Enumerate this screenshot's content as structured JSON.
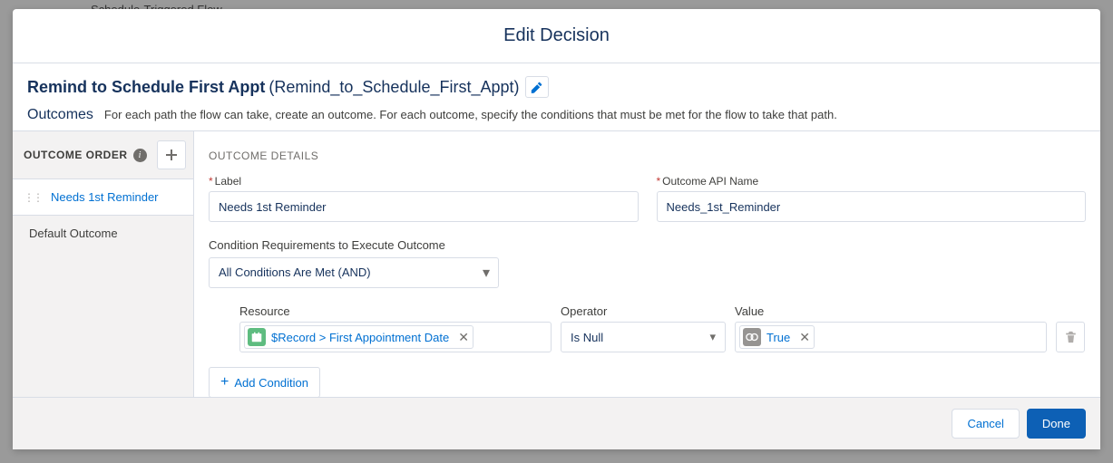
{
  "background": {
    "flow_type": "Schedule-Triggered Flow"
  },
  "modal": {
    "title": "Edit Decision",
    "element_label": "Remind to Schedule First Appt",
    "element_api": "(Remind_to_Schedule_First_Appt)",
    "outcomes_heading": "Outcomes",
    "outcomes_desc": "For each path the flow can take, create an outcome. For each outcome, specify the conditions that must be met for the flow to take that path."
  },
  "sidebar": {
    "order_label": "OUTCOME ORDER",
    "items": [
      {
        "label": "Needs 1st Reminder"
      },
      {
        "label": "Default Outcome"
      }
    ]
  },
  "details": {
    "section_label": "OUTCOME DETAILS",
    "label_field_label": "Label",
    "label_value": "Needs 1st Reminder",
    "api_field_label": "Outcome API Name",
    "api_value": "Needs_1st_Reminder",
    "cond_req_label": "Condition Requirements to Execute Outcome",
    "cond_req_value": "All Conditions Are Met (AND)",
    "condition": {
      "resource_label": "Resource",
      "resource_value": "$Record > First Appointment Date",
      "operator_label": "Operator",
      "operator_value": "Is Null",
      "value_label": "Value",
      "value_value": "True"
    },
    "add_condition": "Add Condition"
  },
  "footer": {
    "cancel": "Cancel",
    "done": "Done"
  }
}
